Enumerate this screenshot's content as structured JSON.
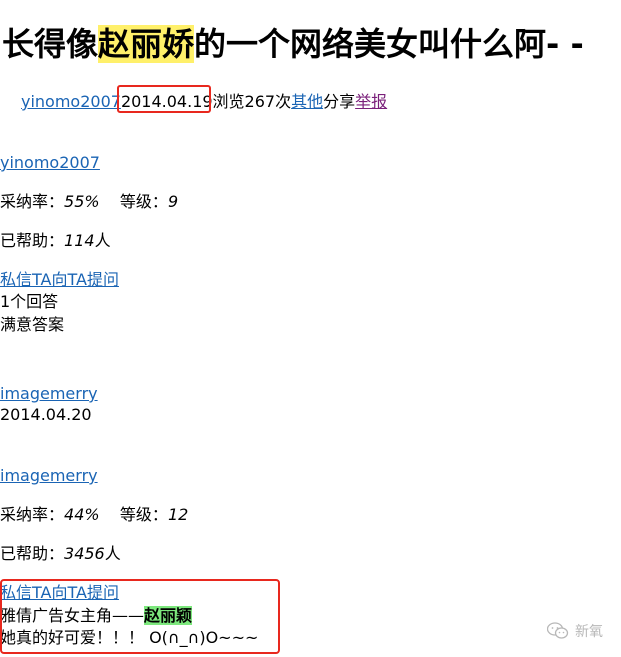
{
  "title": {
    "before": "长得像",
    "highlight": "赵丽娇",
    "after": "的一个网络美女叫什么阿- -"
  },
  "meta": {
    "author": "yinomo2007",
    "date": "2014.04.19",
    "views_text": "浏览267次",
    "other_link": "其他",
    "share_text": "分享",
    "report_link": "举报"
  },
  "answer1": {
    "user": "yinomo2007",
    "rate_label": "采纳率：",
    "rate_value": "55%",
    "level_label": "等级：",
    "level_value": "9",
    "helped_label": "已帮助：",
    "helped_value": "114",
    "helped_unit": "人",
    "message_link": "私信TA向TA提问",
    "answers_count": "1个回答",
    "satisfied": "满意答案"
  },
  "answer2": {
    "user": "imagemerry",
    "date": "2014.04.20"
  },
  "answer3": {
    "user": "imagemerry",
    "rate_label": "采纳率：",
    "rate_value": "44%",
    "level_label": "等级：",
    "level_value": "12",
    "helped_label": "已帮助：",
    "helped_value": "3456",
    "helped_unit": "人",
    "message_link": "私信TA向TA提问",
    "answer_prefix": "雅倩广告女主角——",
    "answer_highlight": "赵丽颖",
    "answer_line2": "她真的好可爱！！！ O(∩_∩)O~~~"
  },
  "watermark": {
    "text": "新氧",
    "icon": "wechat-icon"
  },
  "colors": {
    "link": "#1a64b4",
    "visited_link": "#7a1f7a",
    "highlight_yellow": "#fff06a",
    "highlight_green": "#7de87d",
    "annotation_red": "#e8281e"
  }
}
